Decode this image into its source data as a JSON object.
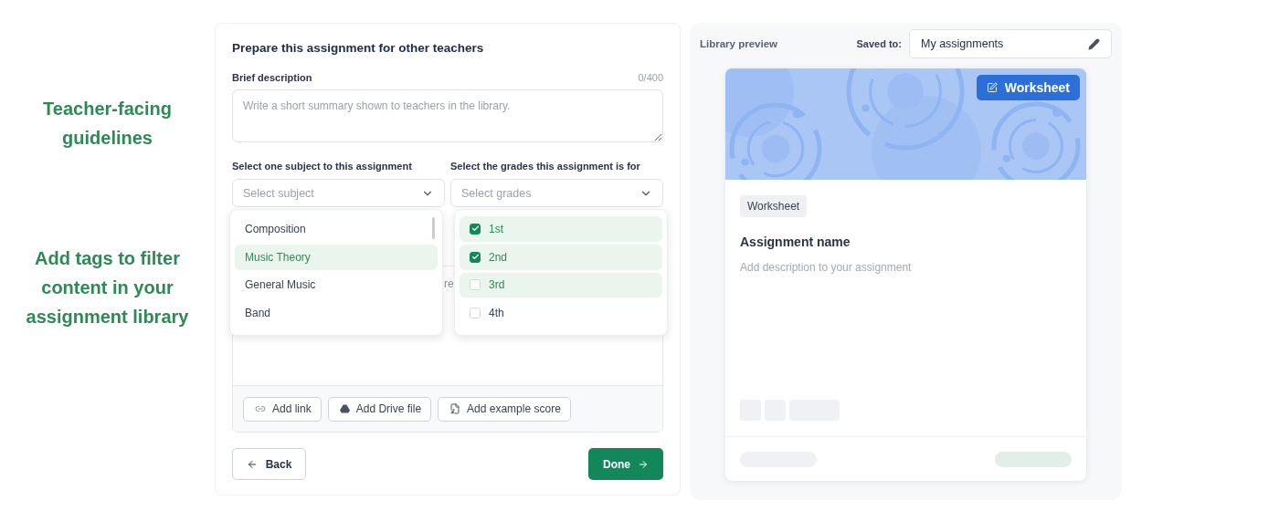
{
  "annotations": [
    {
      "text": "Teacher-facing guidelines"
    },
    {
      "text": "Add tags to filter content in your assignment library"
    }
  ],
  "form": {
    "title": "Prepare this assignment for other teachers",
    "description": {
      "label": "Brief description",
      "counter": "0/400",
      "placeholder": "Write a short summary shown to teachers in the library."
    },
    "subject": {
      "label": "Select one subject to this assignment",
      "placeholder": "Select subject",
      "options": [
        {
          "label": "Composition",
          "highlighted": false
        },
        {
          "label": "Music Theory",
          "highlighted": true
        },
        {
          "label": "General Music",
          "highlighted": false
        },
        {
          "label": "Band",
          "highlighted": false
        }
      ]
    },
    "grades": {
      "label": "Select the grades this assignment is for",
      "placeholder": "Select grades",
      "options": [
        {
          "label": "1st",
          "checked": true,
          "highlighted": true
        },
        {
          "label": "2nd",
          "checked": true,
          "highlighted": true
        },
        {
          "label": "3rd",
          "checked": false,
          "highlighted": true
        },
        {
          "label": "4th",
          "checked": false,
          "highlighted": false
        }
      ]
    },
    "covered_text": "re",
    "attachments": [
      {
        "kind": "link",
        "label": "Add link"
      },
      {
        "kind": "drive",
        "label": "Add Drive file"
      },
      {
        "kind": "score",
        "label": "Add example score"
      }
    ],
    "back": "Back",
    "done": "Done"
  },
  "preview": {
    "title": "Library preview",
    "saved_label": "Saved to:",
    "saved_value": "My assignments",
    "card": {
      "kind_badge": "Worksheet",
      "chip": "Worksheet",
      "name": "Assignment name",
      "description": "Add description to your assignment"
    }
  }
}
